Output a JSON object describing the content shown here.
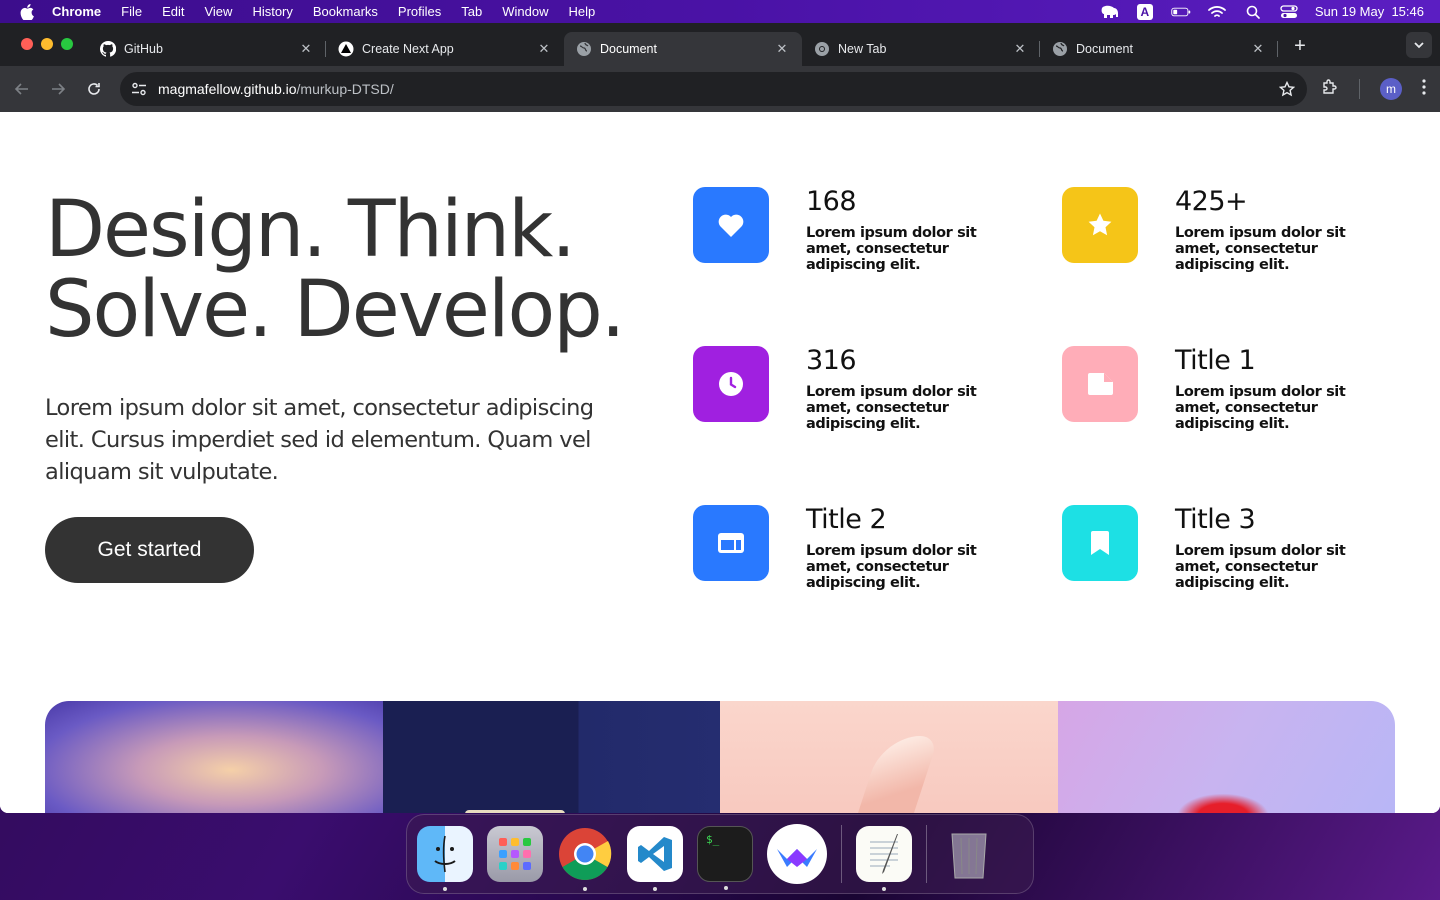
{
  "menubar": {
    "app": "Chrome",
    "items": [
      "File",
      "Edit",
      "View",
      "History",
      "Bookmarks",
      "Profiles",
      "Tab",
      "Window",
      "Help"
    ],
    "clock": "Sun 19 May  15:46",
    "input_source": "A"
  },
  "tabs": [
    {
      "title": "GitHub",
      "icon": "github-icon"
    },
    {
      "title": "Create Next App",
      "icon": "nextjs-icon"
    },
    {
      "title": "Document",
      "icon": "globe-icon",
      "active": true
    },
    {
      "title": "New Tab",
      "icon": "chrome-icon"
    },
    {
      "title": "Document",
      "icon": "globe-icon"
    }
  ],
  "address": {
    "host": "magmafellow.github.io",
    "path": "/murkup-DTSD/"
  },
  "profile_initial": "m",
  "hero": {
    "title": "Design. Think.\nSolve. Develop.",
    "text": "Lorem ipsum dolor sit amet, consectetur adipiscing elit. Cursus imperdiet sed id elementum. Quam vel aliquam sit vulputate.",
    "cta": "Get started"
  },
  "features": [
    {
      "title": "168",
      "desc": "Lorem ipsum dolor sit amet, consectetur adipiscing elit.",
      "icon": "heart-icon",
      "color": "#2979ff"
    },
    {
      "title": "425+",
      "desc": "Lorem ipsum dolor sit amet, consectetur adipiscing elit.",
      "icon": "star-icon",
      "color": "#f5c518"
    },
    {
      "title": "316",
      "desc": "Lorem ipsum dolor sit amet, consectetur adipiscing elit.",
      "icon": "clock-icon",
      "color": "#a020e0"
    },
    {
      "title": "Title 1",
      "desc": "Lorem ipsum dolor sit amet, consectetur adipiscing elit.",
      "icon": "note-icon",
      "color": "#ffadb8"
    },
    {
      "title": "Title 2",
      "desc": "Lorem ipsum dolor sit amet, consectetur adipiscing elit.",
      "icon": "window-icon",
      "color": "#2979ff"
    },
    {
      "title": "Title 3",
      "desc": "Lorem ipsum dolor sit amet, consectetur adipiscing elit.",
      "icon": "bookmark-icon",
      "color": "#1de0e4"
    }
  ],
  "dock": [
    "finder",
    "launchpad",
    "chrome",
    "vscode",
    "terminal",
    "cursor-app",
    "textedit",
    "trash"
  ]
}
